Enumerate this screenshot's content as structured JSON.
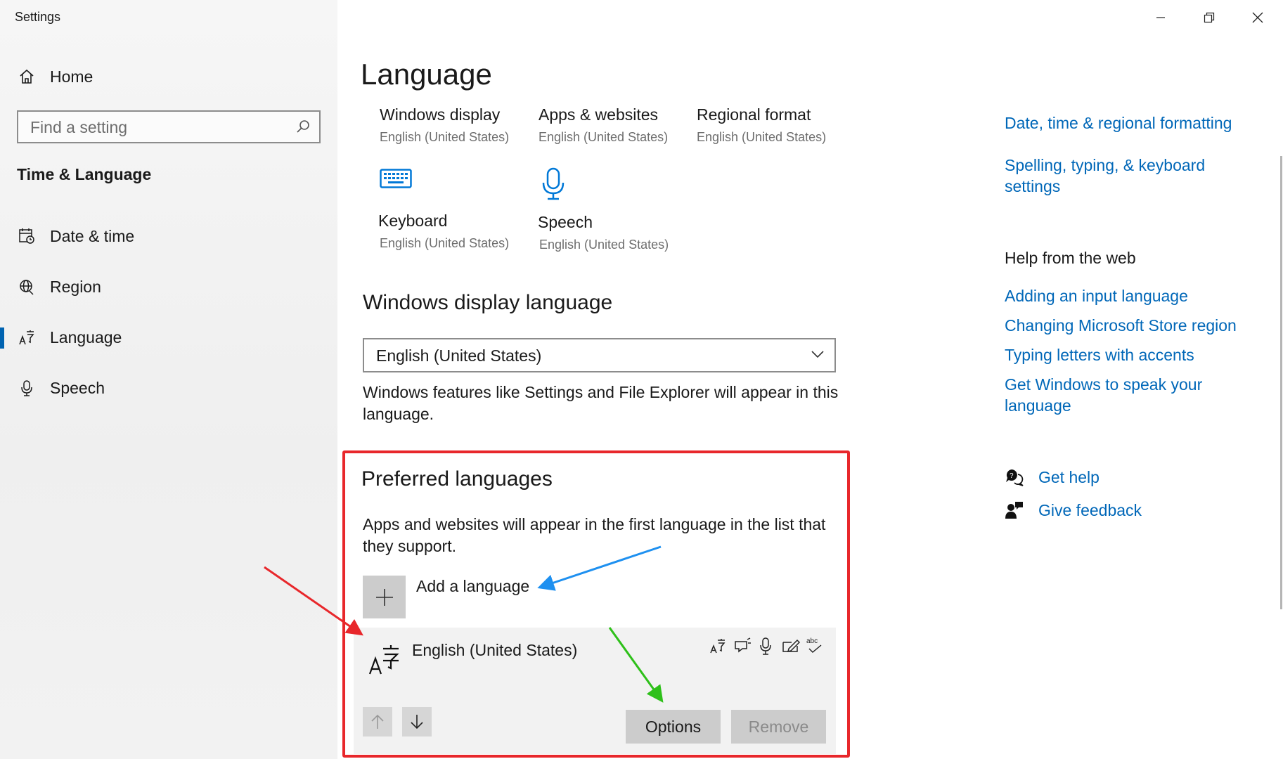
{
  "window": {
    "title": "Settings",
    "controls": [
      "minimize",
      "restore",
      "close"
    ]
  },
  "sidebar": {
    "home_label": "Home",
    "search_placeholder": "Find a setting",
    "section_title": "Time & Language",
    "items": [
      {
        "label": "Date & time",
        "icon": "calendar-clock-icon",
        "selected": false
      },
      {
        "label": "Region",
        "icon": "globe-icon",
        "selected": false
      },
      {
        "label": "Language",
        "icon": "language-icon",
        "selected": true
      },
      {
        "label": "Speech",
        "icon": "microphone-icon",
        "selected": false
      }
    ]
  },
  "main": {
    "title": "Language",
    "tiles": [
      {
        "title": "Windows display",
        "subtitle": "English (United States)"
      },
      {
        "title": "Apps & websites",
        "subtitle": "English (United States)"
      },
      {
        "title": "Regional format",
        "subtitle": "English (United States)"
      },
      {
        "title": "Keyboard",
        "subtitle": "English (United States)",
        "icon": "keyboard-icon"
      },
      {
        "title": "Speech",
        "subtitle": "English (United States)",
        "icon": "microphone-icon"
      }
    ],
    "display_language": {
      "heading": "Windows display language",
      "selected": "English (United States)",
      "description": "Windows features like Settings and File Explorer will appear in this language."
    },
    "preferred": {
      "heading": "Preferred languages",
      "description": "Apps and websites will appear in the first language in the list that they support.",
      "add_label": "Add a language",
      "languages": [
        {
          "name": "English (United States)",
          "features": [
            "display-language-icon",
            "text-to-speech-icon",
            "speech-recognition-icon",
            "handwriting-icon",
            "spell-check-icon"
          ]
        }
      ],
      "options_label": "Options",
      "remove_label": "Remove"
    }
  },
  "right": {
    "related_links": [
      "Date, time & regional formatting",
      "Spelling, typing, & keyboard settings"
    ],
    "help_heading": "Help from the web",
    "help_links": [
      "Adding an input language",
      "Changing Microsoft Store region",
      "Typing letters with accents",
      "Get Windows to speak your language"
    ],
    "get_help": "Get help",
    "give_feedback": "Give feedback"
  },
  "colors": {
    "accent": "#0067b8",
    "highlight_box": "#e8272b",
    "arrow_red": "#e8272b",
    "arrow_blue": "#1e90f0",
    "arrow_green": "#2ec01a"
  }
}
